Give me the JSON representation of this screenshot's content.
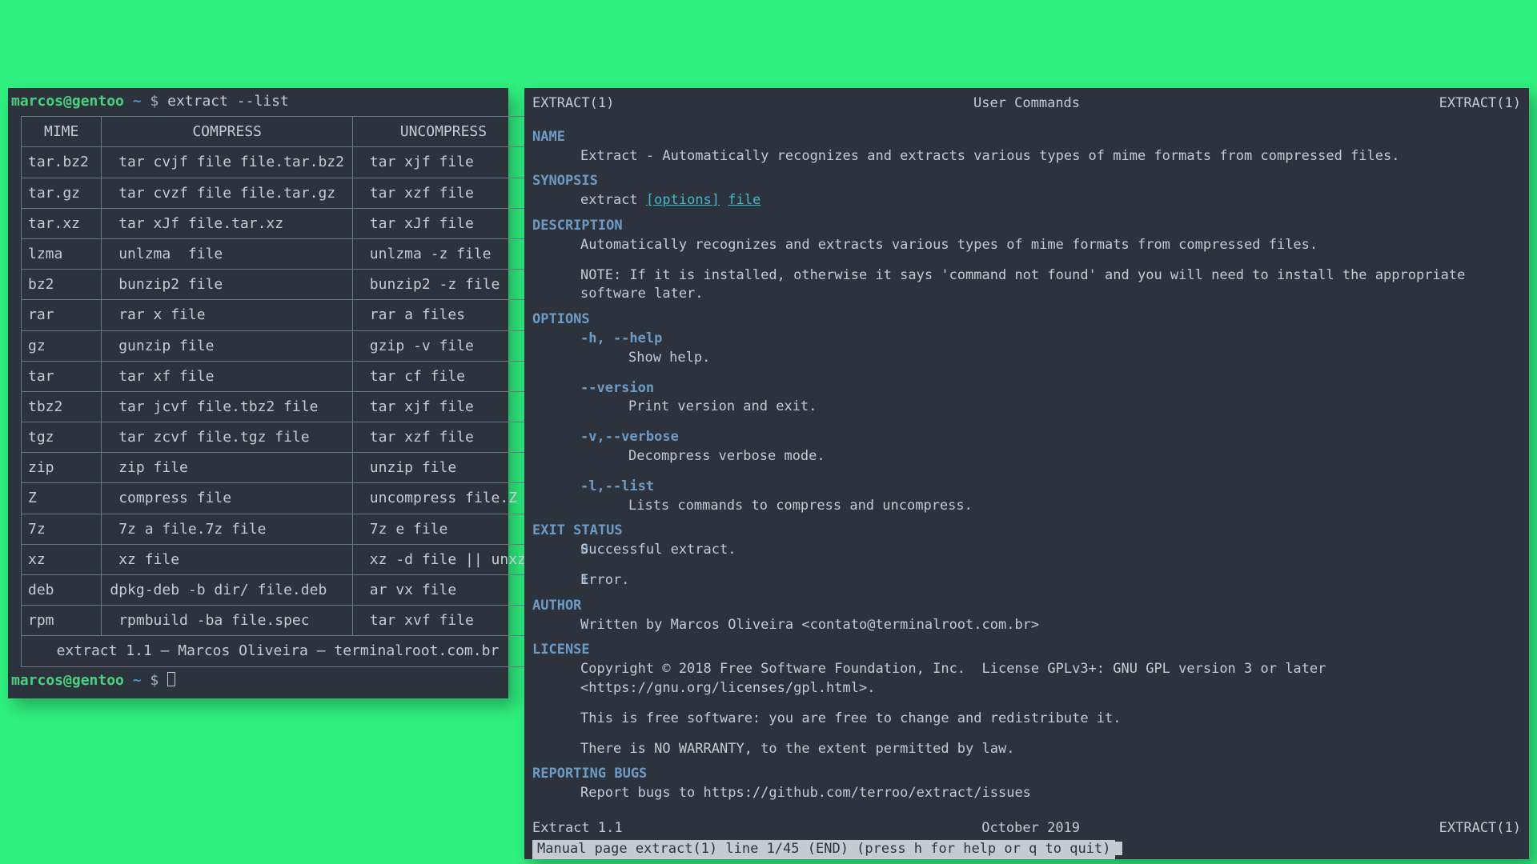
{
  "prompt": {
    "user": "marcos@gentoo",
    "path": "~",
    "symbol": "$",
    "command": "extract --list"
  },
  "table": {
    "headers": [
      "MIME",
      "COMPRESS",
      "UNCOMPRESS"
    ],
    "rows": [
      [
        "tar.bz2",
        " tar cvjf file file.tar.bz2",
        " tar xjf file"
      ],
      [
        "tar.gz",
        " tar cvzf file file.tar.gz",
        " tar xzf file"
      ],
      [
        "tar.xz",
        " tar xJf file.tar.xz",
        " tar xJf file"
      ],
      [
        "lzma",
        " unlzma  file",
        " unlzma -z file"
      ],
      [
        "bz2",
        " bunzip2 file",
        " bunzip2 -z file"
      ],
      [
        "rar",
        " rar x file",
        " rar a files"
      ],
      [
        "gz",
        " gunzip file",
        " gzip -v file"
      ],
      [
        "tar",
        " tar xf file",
        " tar cf file"
      ],
      [
        "tbz2",
        " tar jcvf file.tbz2 file",
        " tar xjf file"
      ],
      [
        "tgz",
        " tar zcvf file.tgz file",
        " tar xzf file"
      ],
      [
        "zip",
        " zip file",
        " unzip file"
      ],
      [
        "Z",
        " compress file",
        " uncompress file.Z"
      ],
      [
        "7z",
        " 7z a file.7z file",
        " 7z e file"
      ],
      [
        "xz",
        " xz file",
        " xz -d file || unxz"
      ],
      [
        "deb",
        "dpkg-deb -b dir/ file.deb",
        " ar vx file"
      ],
      [
        "rpm",
        " rpmbuild -ba file.spec",
        " tar xvf file"
      ]
    ],
    "footer": "extract 1.1 – Marcos Oliveira – terminalroot.com.br"
  },
  "man": {
    "header": {
      "left": "EXTRACT(1)",
      "center": "User Commands",
      "right": "EXTRACT(1)"
    },
    "name_sect": "NAME",
    "name_text": "Extract - Automatically recognizes and extracts various types of mime formats from compressed files.",
    "synopsis_sect": "SYNOPSIS",
    "synopsis_cmd": "extract",
    "synopsis_opt": "[options]",
    "synopsis_file": "file",
    "desc_sect": "DESCRIPTION",
    "desc_text1": "Automatically recognizes and extracts various types of mime formats from compressed files.",
    "desc_text2": "NOTE: If it is installed, otherwise it says 'command not found' and you will need to install the appropriate software later.",
    "options_sect": "OPTIONS",
    "opt_help": "-h, --help",
    "opt_help_desc": "Show help.",
    "opt_version": "--version",
    "opt_version_desc": "Print version and exit.",
    "opt_verbose": "-v,--verbose",
    "opt_verbose_desc": "Decompress verbose mode.",
    "opt_list": "-l,--list",
    "opt_list_desc": "Lists commands to compress and uncompress.",
    "exit_sect": "EXIT STATUS",
    "exit_0": "0",
    "exit_0_desc": "Successful extract.",
    "exit_1": "1",
    "exit_1_desc": "Error.",
    "author_sect": "AUTHOR",
    "author_text": "Written by Marcos Oliveira <contato@terminalroot.com.br>",
    "license_sect": "LICENSE",
    "license_1": "Copyright © 2018 Free Software Foundation, Inc.  License GPLv3+: GNU GPL version 3 or later <https://gnu.org/licenses/gpl.html>.",
    "license_2": "This is free software: you are free to change and redistribute it.",
    "license_3": "There is NO WARRANTY, to the extent permitted by law.",
    "bugs_sect": "REPORTING BUGS",
    "bugs_text": "Report bugs to https://github.com/terroo/extract/issues",
    "footer": {
      "left": "Extract 1.1",
      "center": "October 2019",
      "right": "EXTRACT(1)"
    },
    "statusbar": " Manual page extract(1) line 1/45 (END) (press h for help or q to quit)"
  }
}
